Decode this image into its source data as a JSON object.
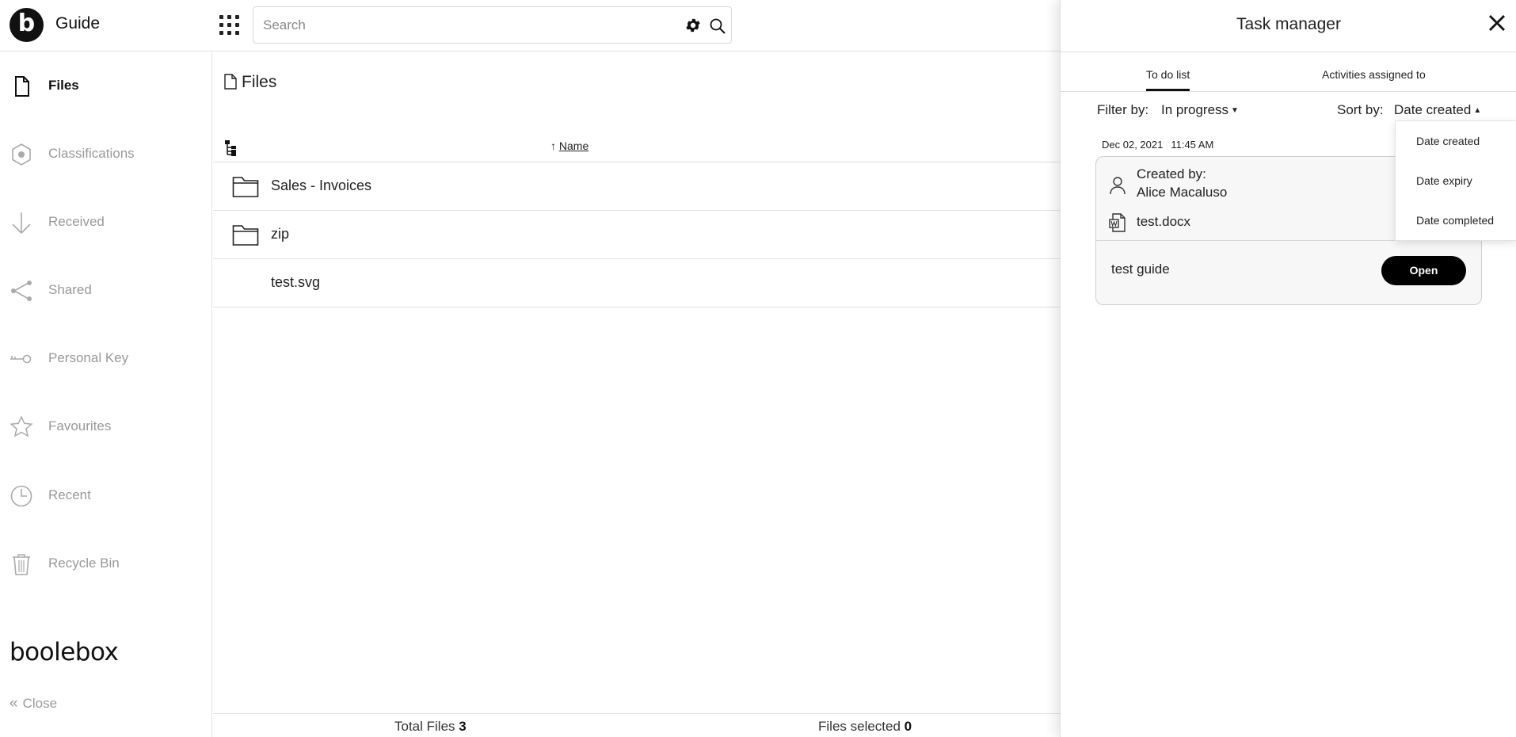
{
  "app": {
    "title": "Guide",
    "logo_letter": "b",
    "brand": "boolebox"
  },
  "search": {
    "placeholder": "Search",
    "value": ""
  },
  "sidebar": {
    "items": [
      {
        "label": "Files",
        "icon": "file-icon",
        "active": true
      },
      {
        "label": "Classifications",
        "icon": "hexagon-icon",
        "active": false
      },
      {
        "label": "Received",
        "icon": "arrow-down-icon",
        "active": false
      },
      {
        "label": "Shared",
        "icon": "share-icon",
        "active": false
      },
      {
        "label": "Personal Key",
        "icon": "key-icon",
        "active": false
      },
      {
        "label": "Favourites",
        "icon": "star-icon",
        "active": false
      },
      {
        "label": "Recent",
        "icon": "clock-icon",
        "active": false
      },
      {
        "label": "Recycle Bin",
        "icon": "trash-icon",
        "active": false
      }
    ],
    "close_label": "Close"
  },
  "main": {
    "title": "Files",
    "column_name": "Name",
    "rows": [
      {
        "name": "Sales - Invoices",
        "type": "folder"
      },
      {
        "name": "zip",
        "type": "folder"
      },
      {
        "name": "test.svg",
        "type": "file"
      }
    ],
    "footer": {
      "total_label": "Total Files",
      "total_value": "3",
      "selected_label": "Files selected",
      "selected_value": "0"
    }
  },
  "task_manager": {
    "title": "Task manager",
    "tabs": [
      {
        "label": "To do list",
        "active": true
      },
      {
        "label": "Activities assigned to",
        "active": false
      }
    ],
    "filter": {
      "label": "Filter by:",
      "value": "In progress"
    },
    "sort": {
      "label": "Sort by:",
      "value": "Date created",
      "options": [
        "Date created",
        "Date expiry",
        "Date completed"
      ]
    },
    "task": {
      "date": "Dec 02, 2021",
      "time": "11:45 AM",
      "created_by_label": "Created by:",
      "created_by": "Alice Macaluso",
      "file": "test.docx",
      "name": "test guide",
      "open_label": "Open"
    }
  },
  "colors": {
    "accent": "#000000",
    "muted_text": "#999999",
    "text": "#222222"
  }
}
